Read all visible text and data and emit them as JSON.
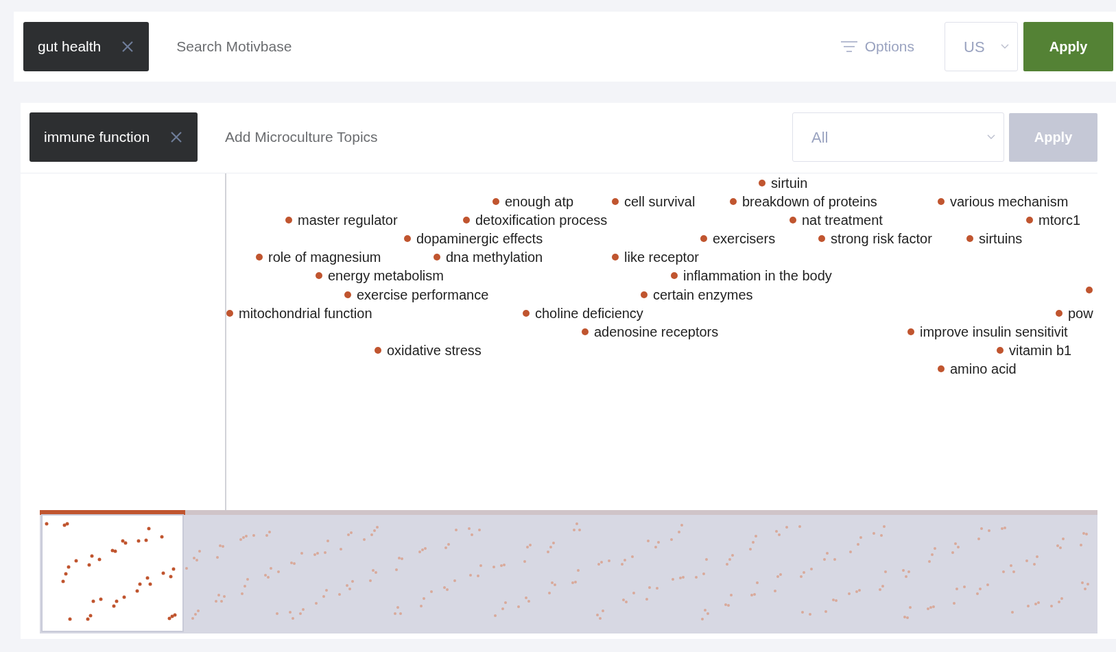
{
  "search": {
    "tag": "gut health",
    "placeholder": "Search Motivbase",
    "options_label": "Options",
    "region": "US",
    "apply_label": "Apply"
  },
  "topics": {
    "tag": "immune function",
    "placeholder": "Add Microculture Topics",
    "filter": "All",
    "apply_label": "Apply",
    "apply_disabled": true
  },
  "cloud_terms": [
    {
      "kind": "term",
      "label": "sirtuin"
    },
    {
      "kind": "term",
      "label": "enough atp"
    },
    {
      "kind": "term",
      "label": "cell survival"
    },
    {
      "kind": "term",
      "label": "breakdown of proteins"
    },
    {
      "kind": "term",
      "label": "various mechanism"
    },
    {
      "kind": "term",
      "label": "master regulator"
    },
    {
      "kind": "term",
      "label": "detoxification process"
    },
    {
      "kind": "term",
      "label": "nat treatment"
    },
    {
      "kind": "term",
      "label": "mtorc1"
    },
    {
      "kind": "term",
      "label": "dopaminergic effects"
    },
    {
      "kind": "term",
      "label": "exercisers"
    },
    {
      "kind": "term",
      "label": "strong risk factor"
    },
    {
      "kind": "term",
      "label": "sirtuins"
    },
    {
      "kind": "term",
      "label": "role of magnesium"
    },
    {
      "kind": "term",
      "label": "dna methylation"
    },
    {
      "kind": "term",
      "label": "like receptor"
    },
    {
      "kind": "term",
      "label": "energy metabolism"
    },
    {
      "kind": "term",
      "label": "inflammation in the body"
    },
    {
      "kind": "term",
      "label": "exercise performance"
    },
    {
      "kind": "term",
      "label": "certain enzymes"
    },
    {
      "kind": "dot"
    },
    {
      "kind": "term",
      "label": "mitochondrial function"
    },
    {
      "kind": "term",
      "label": "choline deficiency"
    },
    {
      "kind": "term",
      "label": "pow"
    },
    {
      "kind": "term",
      "label": "adenosine receptors"
    },
    {
      "kind": "term",
      "label": "improve insulin sensitivit"
    },
    {
      "kind": "term",
      "label": "oxidative stress"
    },
    {
      "kind": "term",
      "label": "vitamin b1"
    },
    {
      "kind": "term",
      "label": "amino acid"
    }
  ]
}
